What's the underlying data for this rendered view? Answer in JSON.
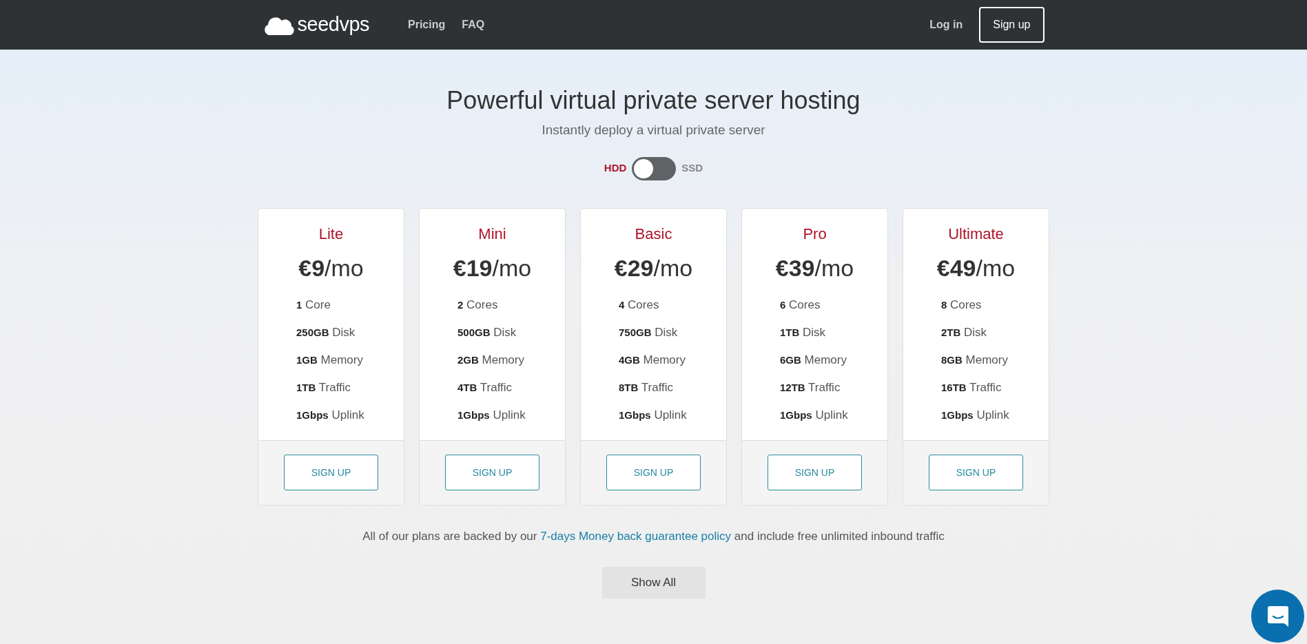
{
  "navbar": {
    "brand": "seedvps",
    "links": [
      "Pricing",
      "FAQ"
    ],
    "login": "Log in",
    "signup": "Sign up"
  },
  "hero": {
    "title": "Powerful virtual private server hosting",
    "subtitle": "Instantly deploy a virtual private server"
  },
  "storage_toggle": {
    "left": "HDD",
    "right": "SSD",
    "on": false
  },
  "plans": [
    {
      "name": "Lite",
      "price": "€9",
      "period": "/mo",
      "features": [
        {
          "value": "1",
          "unit": "Core"
        },
        {
          "value": "250GB",
          "unit": "Disk"
        },
        {
          "value": "1GB",
          "unit": "Memory"
        },
        {
          "value": "1TB",
          "unit": "Traffic"
        },
        {
          "value": "1Gbps",
          "unit": "Uplink"
        }
      ],
      "button": "SIGN UP"
    },
    {
      "name": "Mini",
      "price": "€19",
      "period": "/mo",
      "features": [
        {
          "value": "2",
          "unit": "Cores"
        },
        {
          "value": "500GB",
          "unit": "Disk"
        },
        {
          "value": "2GB",
          "unit": "Memory"
        },
        {
          "value": "4TB",
          "unit": "Traffic"
        },
        {
          "value": "1Gbps",
          "unit": "Uplink"
        }
      ],
      "button": "SIGN UP"
    },
    {
      "name": "Basic",
      "price": "€29",
      "period": "/mo",
      "features": [
        {
          "value": "4",
          "unit": "Cores"
        },
        {
          "value": "750GB",
          "unit": "Disk"
        },
        {
          "value": "4GB",
          "unit": "Memory"
        },
        {
          "value": "8TB",
          "unit": "Traffic"
        },
        {
          "value": "1Gbps",
          "unit": "Uplink"
        }
      ],
      "button": "SIGN UP"
    },
    {
      "name": "Pro",
      "price": "€39",
      "period": "/mo",
      "features": [
        {
          "value": "6",
          "unit": "Cores"
        },
        {
          "value": "1TB",
          "unit": "Disk"
        },
        {
          "value": "6GB",
          "unit": "Memory"
        },
        {
          "value": "12TB",
          "unit": "Traffic"
        },
        {
          "value": "1Gbps",
          "unit": "Uplink"
        }
      ],
      "button": "SIGN UP"
    },
    {
      "name": "Ultimate",
      "price": "€49",
      "period": "/mo",
      "features": [
        {
          "value": "8",
          "unit": "Cores"
        },
        {
          "value": "2TB",
          "unit": "Disk"
        },
        {
          "value": "8GB",
          "unit": "Memory"
        },
        {
          "value": "16TB",
          "unit": "Traffic"
        },
        {
          "value": "1Gbps",
          "unit": "Uplink"
        }
      ],
      "button": "SIGN UP"
    }
  ],
  "guarantee": {
    "before": "All of our plans are backed by our",
    "link": "7-days Money back guarantee policy",
    "after": "and include free unlimited inbound traffic"
  },
  "show_all": "Show All"
}
